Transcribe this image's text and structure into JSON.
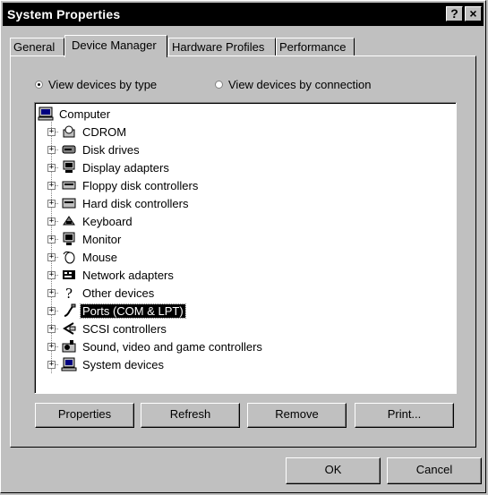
{
  "window": {
    "title": "System Properties",
    "help_button": "?",
    "close_button": "×"
  },
  "tabs": [
    {
      "label": "General"
    },
    {
      "label": "Device Manager"
    },
    {
      "label": "Hardware Profiles"
    },
    {
      "label": "Performance"
    }
  ],
  "view_options": {
    "by_type": "View devices by type",
    "by_connection": "View devices by connection",
    "selected": "by_type"
  },
  "tree": {
    "root": "Computer",
    "items": [
      {
        "label": "CDROM",
        "icon": "cdrom-icon"
      },
      {
        "label": "Disk drives",
        "icon": "disk-drive-icon"
      },
      {
        "label": "Display adapters",
        "icon": "display-adapter-icon"
      },
      {
        "label": "Floppy disk controllers",
        "icon": "floppy-controller-icon"
      },
      {
        "label": "Hard disk controllers",
        "icon": "hard-disk-controller-icon"
      },
      {
        "label": "Keyboard",
        "icon": "keyboard-icon"
      },
      {
        "label": "Monitor",
        "icon": "monitor-icon"
      },
      {
        "label": "Mouse",
        "icon": "mouse-icon"
      },
      {
        "label": "Network adapters",
        "icon": "network-adapter-icon"
      },
      {
        "label": "Other devices",
        "icon": "question-mark-icon"
      },
      {
        "label": "Ports (COM & LPT)",
        "icon": "ports-icon",
        "selected": true
      },
      {
        "label": "SCSI controllers",
        "icon": "scsi-icon"
      },
      {
        "label": "Sound, video and game controllers",
        "icon": "sound-icon"
      },
      {
        "label": "System devices",
        "icon": "system-device-icon"
      }
    ]
  },
  "panel_buttons": {
    "properties": "Properties",
    "refresh": "Refresh",
    "remove": "Remove",
    "print": "Print..."
  },
  "dialog_buttons": {
    "ok": "OK",
    "cancel": "Cancel"
  }
}
